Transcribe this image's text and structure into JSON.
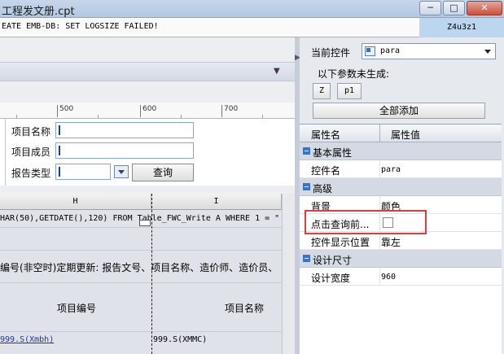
{
  "window": {
    "title": "工程发文册.cpt",
    "min_label": "─",
    "max_label": "□",
    "close_label": "✕"
  },
  "error_bar": {
    "message": "EATE EMB-DB: SET LOGSIZE FAILED!",
    "code": "Z4u3z1"
  },
  "ruler": {
    "ticks": [
      "500",
      "600",
      "700"
    ]
  },
  "form": {
    "fields": [
      {
        "label": "项目名称"
      },
      {
        "label": "项目成员"
      },
      {
        "label": "报告类型"
      }
    ],
    "query_button": "查询"
  },
  "grid": {
    "columns": [
      "H",
      "I"
    ],
    "sql_text": "HAR(50),GETDATE(),120) FROM Table_FWC_Write A WHERE 1 = \"",
    "note_text": "编号(非空时)定期更新: 报告文号、项目名称、造价师、造价员、",
    "header_h": "项目编号",
    "header_i": "项目名称",
    "cell_h": "999.S(Xmbh)",
    "cell_i": "999.S(XMMC)"
  },
  "right_panel": {
    "control_label": "当前控件",
    "control_value": "para",
    "params_label": "以下参数未生成:",
    "param_buttons": [
      "Z",
      "p1"
    ],
    "add_all": "全部添加",
    "table_headers": {
      "name": "属性名",
      "value": "属性值"
    },
    "groups": [
      {
        "title": "基本属性",
        "rows": [
          {
            "name": "控件名",
            "value": "para",
            "mono": true
          }
        ]
      },
      {
        "title": "高级",
        "rows": [
          {
            "name": "背景",
            "value": "颜色"
          },
          {
            "name": "点击查询前...",
            "value": "",
            "checkbox": true,
            "checked": false
          },
          {
            "name": "控件显示位置",
            "value": "靠左"
          }
        ]
      },
      {
        "title": "设计尺寸",
        "rows": [
          {
            "name": "设计宽度",
            "value": "960",
            "mono": true
          }
        ]
      }
    ]
  }
}
